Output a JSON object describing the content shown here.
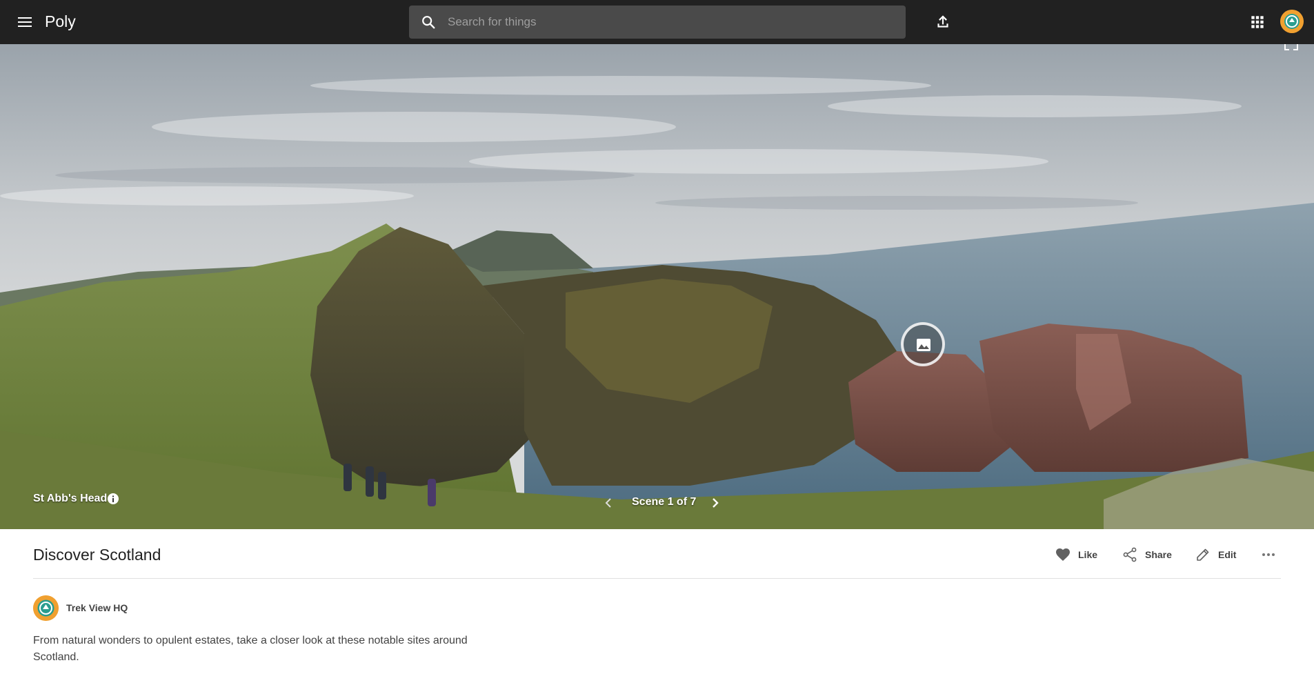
{
  "header": {
    "app_name": "Poly",
    "search_placeholder": "Search for things"
  },
  "pano": {
    "place_name": "St Abb's Head",
    "scene_counter": "Scene 1 of 7"
  },
  "content": {
    "title": "Discover Scotland",
    "actions": {
      "like": "Like",
      "share": "Share",
      "edit": "Edit"
    },
    "author": "Trek View HQ",
    "description": "From natural wonders to opulent estates, take a closer look at these notable sites around Scotland."
  },
  "colors": {
    "topbar": "#212121",
    "search_bg": "#4a4a4a",
    "avatar_orange": "#f0a030",
    "avatar_teal": "#2a9d8f"
  },
  "icons": [
    "menu-icon",
    "search-icon",
    "upload-icon",
    "apps-grid-icon",
    "fullscreen-icon",
    "image-icon",
    "info-icon",
    "chevron-left-icon",
    "chevron-right-icon",
    "heart-icon",
    "share-icon",
    "pencil-icon",
    "more-horiz-icon"
  ]
}
